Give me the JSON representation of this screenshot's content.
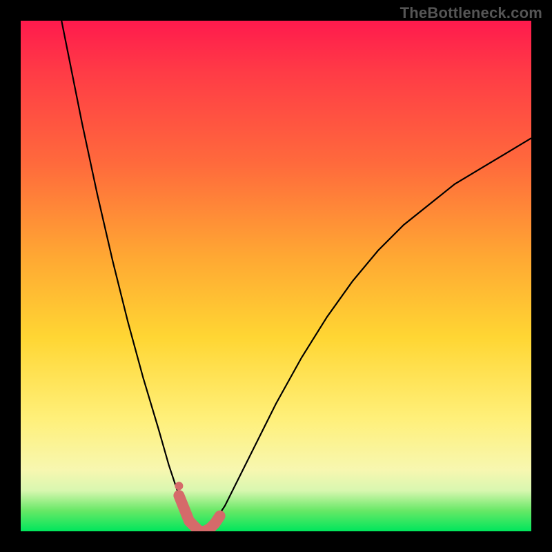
{
  "watermark": "TheBottleneck.com",
  "colors": {
    "frame": "#000000",
    "curve": "#000000",
    "marker": "#d56a6a",
    "gradient_top": "#ff1a4d",
    "gradient_bottom": "#00e65c"
  },
  "chart_data": {
    "type": "line",
    "title": "",
    "xlabel": "",
    "ylabel": "",
    "xlim": [
      0,
      100
    ],
    "ylim": [
      0,
      100
    ],
    "grid": false,
    "series": [
      {
        "name": "curve",
        "x": [
          8,
          10,
          12,
          15,
          18,
          21,
          24,
          27,
          29,
          31,
          33,
          34,
          35,
          36,
          38,
          40,
          42,
          45,
          50,
          55,
          60,
          65,
          70,
          75,
          80,
          85,
          90,
          95,
          100
        ],
        "y": [
          100,
          90,
          80,
          66,
          53,
          41,
          30,
          20,
          13,
          7,
          3,
          1,
          0,
          0.5,
          2,
          5,
          9,
          15,
          25,
          34,
          42,
          49,
          55,
          60,
          64,
          68,
          71,
          74,
          77
        ]
      }
    ],
    "minimum_marker": {
      "x_range": [
        31,
        39
      ],
      "y": 0,
      "values_x": [
        31,
        33,
        34,
        35,
        36,
        37,
        38,
        39
      ],
      "values_y": [
        7,
        2,
        1,
        0,
        0,
        0.5,
        1.5,
        3
      ]
    }
  }
}
